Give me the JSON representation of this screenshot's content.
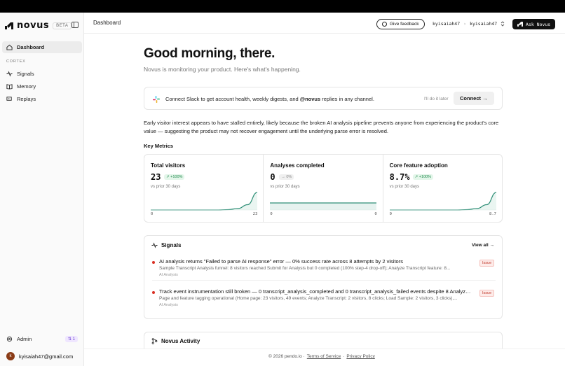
{
  "app": {
    "brand": "novus",
    "beta_label": "BETA"
  },
  "sidebar": {
    "dashboard_label": "Dashboard",
    "section_label": "CORTEX",
    "items": [
      {
        "label": "Signals",
        "icon": "pulse-icon"
      },
      {
        "label": "Memory",
        "icon": "book-icon"
      },
      {
        "label": "Replays",
        "icon": "replay-icon"
      }
    ],
    "admin_label": "Admin",
    "admin_badge": "⇅ 1",
    "user_initial": "k",
    "user_email": "kyisaiah47@gmail.com"
  },
  "header": {
    "breadcrumb": "Dashboard",
    "feedback_label": "Give feedback",
    "workspace": "kyisaiah47",
    "project": "kyisaiah47",
    "sep": "›",
    "ask_label": "Ask Novus"
  },
  "main": {
    "greeting": "Good morning, there.",
    "subtitle": "Novus is monitoring your product. Here's what's happening.",
    "slack": {
      "text_before": "Connect Slack to get account health, weekly digests, and ",
      "text_bold": "@novus",
      "text_after": " replies in any channel.",
      "later_label": "I'll do it later",
      "connect_label": "Connect →"
    },
    "summary": "Early visitor interest appears to have stalled entirely, likely because the broken AI analysis pipeline prevents anyone from experiencing the product's core value — suggesting the product may not recover engagement until the underlying parse error is resolved.",
    "key_metrics_title": "Key Metrics",
    "metrics": [
      {
        "title": "Total visitors",
        "value": "23",
        "badge": "↗ +100%",
        "badge_type": "up",
        "sub": "vs prior 30 days",
        "axis_start": "0",
        "axis_end": "23",
        "trend": [
          0,
          0,
          0,
          0,
          0,
          0,
          0,
          0,
          0.02,
          0.08,
          0.3,
          1.0
        ]
      },
      {
        "title": "Analyses completed",
        "value": "0",
        "badge": "→ 0%",
        "badge_type": "flat",
        "sub": "vs prior 30 days",
        "axis_start": "0",
        "axis_end": "0",
        "trend": [
          0,
          0,
          0,
          0,
          0,
          0,
          0,
          0,
          0,
          0,
          0,
          0
        ]
      },
      {
        "title": "Core feature adoption",
        "value": "8.7%",
        "badge": "↗ +100%",
        "badge_type": "up",
        "sub": "vs prior 30 days",
        "axis_start": "0",
        "axis_end": "8.7",
        "trend": [
          0,
          0,
          0,
          0,
          0,
          0,
          0,
          0,
          0.02,
          0.08,
          0.3,
          1.0
        ]
      }
    ],
    "signals": {
      "title": "Signals",
      "view_all": "View all →",
      "items": [
        {
          "title": "AI analysis returns \"Failed to parse AI response\" error — 0% success rate across 8 attempts by 2 visitors",
          "desc": "Sample Transcript Analysis funnel: 8 visitors reached Submit for Analysis but 0 completed (100% step-4 drop-off); Analyze Transcript feature: 8...",
          "tag": "AI Analysis",
          "status": "Issue"
        },
        {
          "title": "Track event instrumentation still broken — 0 transcript_analysis_completed and 0 transcript_analysis_failed events despite 8 Analyze...",
          "desc": "Page and feature tagging operational (Home page: 23 visitors, 49 events; Analyze Transcript: 2 visitors, 8 clicks; Load Sample: 2 visitors, 3 clicks),...",
          "tag": "AI Analysis",
          "status": "Issue"
        }
      ]
    },
    "activity_title": "Novus Activity"
  },
  "footer": {
    "copyright": "© 2026 pendo.io ·",
    "terms": "Terms of Service",
    "dot": "·",
    "privacy": "Privacy Policy"
  },
  "colors": {
    "accent_green": "#2f8f77",
    "issue_red": "#d93025",
    "admin_purple": "#6b3fd1"
  }
}
